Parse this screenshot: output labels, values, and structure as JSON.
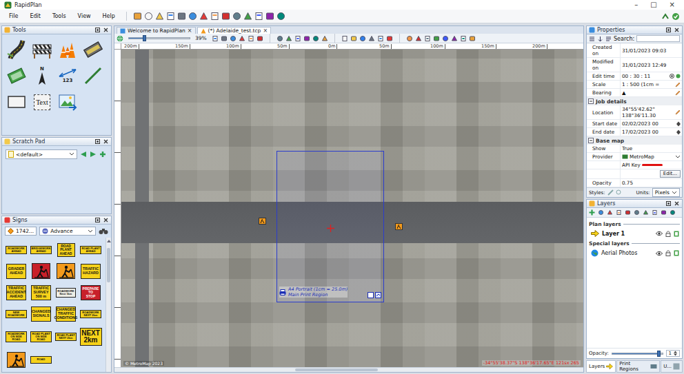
{
  "window": {
    "title": "RapidPlan",
    "controls": [
      "–",
      "□",
      "×"
    ]
  },
  "menu": [
    "File",
    "Edit",
    "Tools",
    "View",
    "Help"
  ],
  "tools_panel": {
    "title": "Tools",
    "items": [
      {
        "kind": "road"
      },
      {
        "kind": "barrier"
      },
      {
        "kind": "cones"
      },
      {
        "kind": "plate"
      },
      {
        "kind": "pad"
      },
      {
        "kind": "north",
        "text": "N"
      },
      {
        "kind": "dimension",
        "text": "123"
      },
      {
        "kind": "line"
      },
      {
        "kind": "rect"
      },
      {
        "kind": "text",
        "text": "Text"
      },
      {
        "kind": "image"
      }
    ]
  },
  "scratch_pad": {
    "title": "Scratch Pad",
    "selection": "<default>"
  },
  "signs_panel": {
    "title": "Signs",
    "code": "1742...",
    "category": "Advance",
    "signs": [
      {
        "kind": "wide",
        "text": "ROADWORK\nAHEAD"
      },
      {
        "kind": "wide",
        "text": "BRIDGEWORK\nAHEAD"
      },
      {
        "kind": "tall",
        "text": "ROAD\nPLANT\nAHEAD"
      },
      {
        "kind": "wide",
        "text": "ROAD PLANT\nAHEAD"
      },
      {
        "kind": "square",
        "text": "GRADER\nAHEAD"
      },
      {
        "kind": "worker-red"
      },
      {
        "kind": "worker"
      },
      {
        "kind": "square",
        "text": "TRAFFIC\nHAZARD"
      },
      {
        "kind": "square",
        "text": "TRAFFIC\nACCIDENT\nAHEAD"
      },
      {
        "kind": "square",
        "text": "TRAFFIC\nSURVEY\n500 m"
      },
      {
        "kind": "white",
        "text": "ROADWORK\nNext 1km"
      },
      {
        "kind": "red",
        "text": "PREPARE\nTO\nSTOP"
      },
      {
        "kind": "wide",
        "text": "NEW\nROADWORK"
      },
      {
        "kind": "square",
        "text": "CHANGED\nSIGNALS"
      },
      {
        "kind": "square",
        "text": "CHANGED\nTRAFFIC\nCONDITIONS"
      },
      {
        "kind": "wide",
        "text": "ROADWORK\nNEXT 2km"
      },
      {
        "kind": "wide",
        "text": "ROADWORK\nON SIDE ROAD"
      },
      {
        "kind": "wide",
        "text": "ROAD PLANT\nON SIDE ROAD"
      },
      {
        "kind": "wide",
        "text": "ROAD PLANT\nNEXT 2km"
      },
      {
        "kind": "big",
        "text": "NEXT\n2km"
      },
      {
        "kind": "worker"
      },
      {
        "kind": "wide",
        "text": "ROAD"
      }
    ]
  },
  "document_tabs": [
    {
      "label": "Welcome to RapidPlan",
      "close": "×",
      "selected": false
    },
    {
      "label": "(*) Adelaide_test.tcp",
      "close": "×",
      "selected": true
    }
  ],
  "map_toolbar": {
    "zoom": {
      "level": 0.25,
      "reading": "39%"
    }
  },
  "ruler": [
    "200m",
    "150m",
    "100m",
    "50m",
    "0m",
    "50m",
    "100m",
    "150m",
    "200m"
  ],
  "map": {
    "print_region": {
      "label": "A4 Portrait (1cm = 25.0m)",
      "name": "Main Print Region"
    },
    "copyright": "© MetroMap 2023",
    "coordinates": "-34°55'38.37\"S 138°36'17.65\"E  121sx 265"
  },
  "properties": {
    "title": "Properties",
    "search_label": "Search:",
    "rows": [
      {
        "kind": "row",
        "label": "Created on",
        "value": "31/01/2023 09:03"
      },
      {
        "kind": "row",
        "label": "Modified on",
        "value": "31/01/2023 12:49"
      },
      {
        "kind": "row",
        "label": "Edit time",
        "value": "00 : 30 : 11"
      },
      {
        "kind": "row",
        "label": "Scale",
        "value": "1 : 500  (1cm ="
      },
      {
        "kind": "row",
        "label": "Bearing",
        "value": "▲"
      },
      {
        "kind": "section",
        "label": "Job details",
        "expanded": true
      },
      {
        "kind": "row",
        "label": "Location",
        "value": "34°55'42.62\"\n138°36'11.30"
      },
      {
        "kind": "date",
        "label": "Start date",
        "value": "02/02/2023 00"
      },
      {
        "kind": "date",
        "label": "End date",
        "value": "17/02/2023 00"
      },
      {
        "kind": "section",
        "label": "Base map",
        "expanded": true
      },
      {
        "kind": "row",
        "label": "Show",
        "value": "True"
      },
      {
        "kind": "dropdown",
        "label": "Provider",
        "value": "MetroMap"
      },
      {
        "kind": "redacted",
        "label": "",
        "value": "API Key"
      },
      {
        "kind": "button",
        "label": "",
        "value": "Edit..."
      },
      {
        "kind": "row",
        "label": "Opacity",
        "value": "0.75"
      }
    ],
    "styles_label": "Styles:",
    "units_label": "Units:",
    "units_value": "Pixels"
  },
  "layers": {
    "title": "Layers",
    "groups": [
      {
        "title": "Plan layers",
        "items": [
          {
            "name": "Layer 1",
            "kind": "plan",
            "selected": true,
            "visible": true
          }
        ]
      },
      {
        "title": "Special layers",
        "items": [
          {
            "name": "Aerial Photos",
            "kind": "aerial",
            "selected": false,
            "visible": true
          }
        ]
      }
    ],
    "opacity": {
      "label": "Opacity:",
      "level": 0.93,
      "reading": "1"
    }
  },
  "bottom_tabs": [
    {
      "label": "Layers",
      "selected": true
    },
    {
      "label": "Print Regions",
      "selected": false
    },
    {
      "label": "U...",
      "selected": false
    }
  ]
}
